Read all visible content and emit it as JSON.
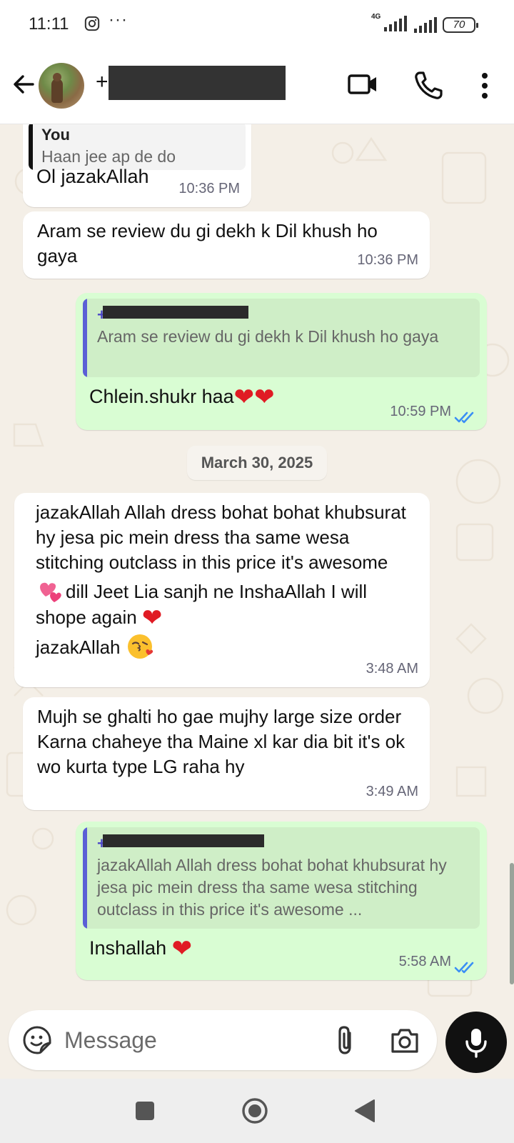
{
  "status_bar": {
    "time": "11:11",
    "more": "···",
    "network": "4G",
    "battery": "70"
  },
  "header": {
    "contact_name": "+",
    "icons": [
      "back-arrow-icon",
      "video-call-icon",
      "voice-call-icon",
      "more-vert-icon"
    ]
  },
  "messages": [
    {
      "direction": "in",
      "quote_author": "You",
      "quote_text": "Haan jee ap de do",
      "text": "Ol jazakAllah",
      "time": "10:36 PM"
    },
    {
      "direction": "in",
      "text": "Aram se review du gi dekh k Dil khush ho gaya",
      "time": "10:36 PM"
    },
    {
      "direction": "out",
      "quote_author": "+",
      "quote_text": "Aram se review du gi dekh k Dil khush ho gaya",
      "text": "Chlein.shukr haa",
      "emoji": "❤❤",
      "time": "10:59 PM",
      "status": "read"
    },
    {
      "direction": "in",
      "text_line1": "jazakAllah Allah dress bohat bohat khubsurat hy jesa pic mein dress tha same wesa stitching outclass in this price it's awesome",
      "text_line2": "dill Jeet Lia sanjh ne InshaAllah I will shope again",
      "text_line3": "jazakAllah",
      "time": "3:48 AM"
    },
    {
      "direction": "in",
      "text": "Mujh se ghalti ho gae mujhy large size order Karna chaheye tha Maine xl kar dia bit it's ok wo kurta type LG raha hy",
      "time": "3:49 AM"
    },
    {
      "direction": "out",
      "quote_author": "+",
      "quote_text": "jazakAllah Allah dress bohat bohat khubsurat hy jesa pic mein dress tha same wesa stitching outclass in this price it's awesome ...",
      "text": "Inshallah",
      "time": "5:58 AM",
      "status": "read"
    }
  ],
  "date_divider": "March 30, 2025",
  "composer": {
    "placeholder": "Message"
  },
  "colors": {
    "incoming_bubble": "#ffffff",
    "outgoing_bubble": "#d9fdd3",
    "read_ticks": "#3b8ff5",
    "quote_bar_out": "#5b5fd6",
    "heart": "#e01b24"
  }
}
